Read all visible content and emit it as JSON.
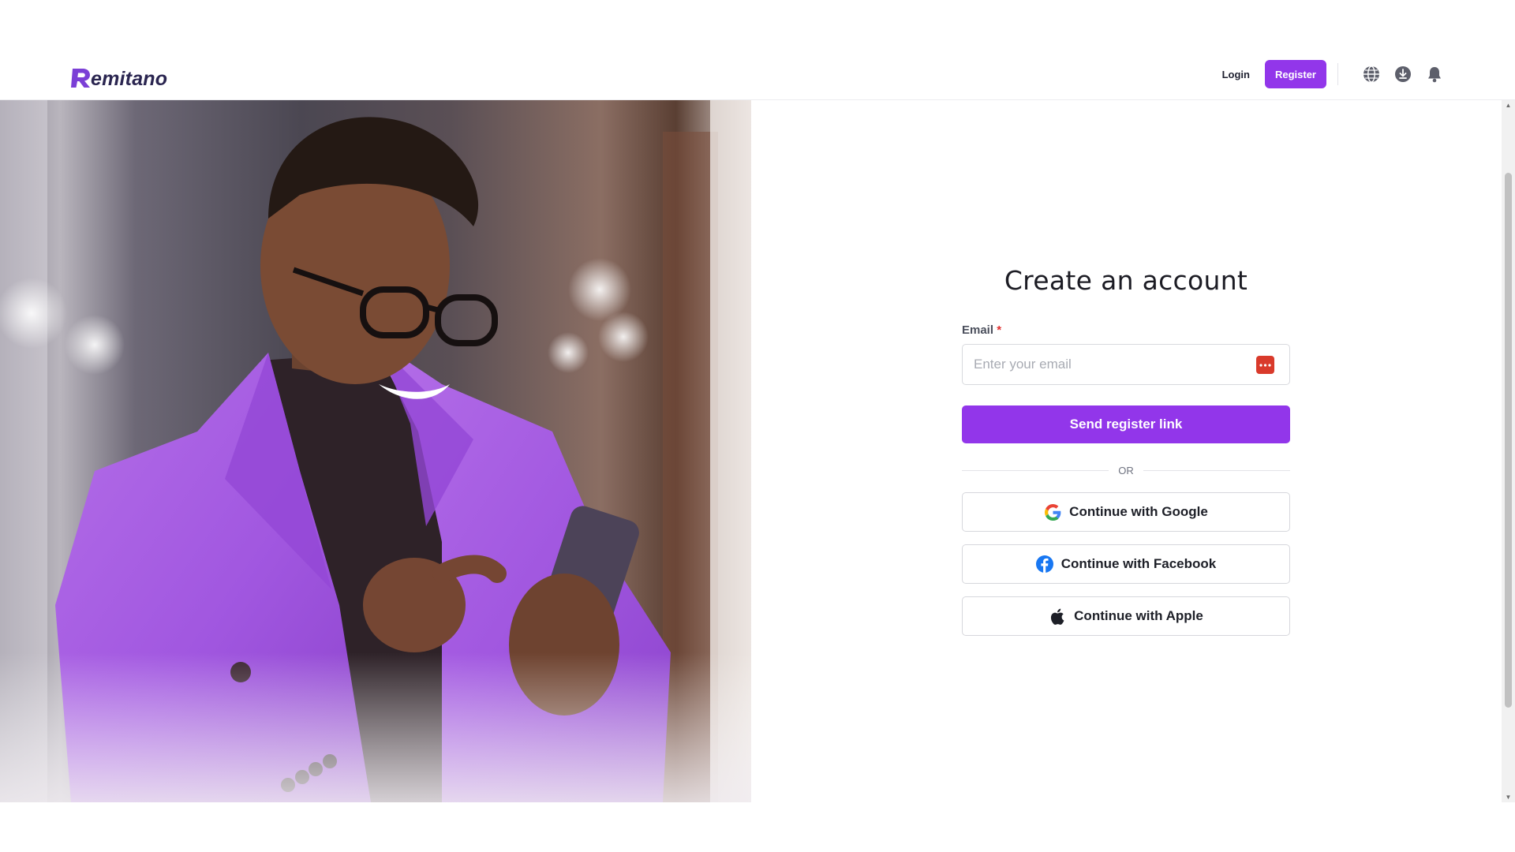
{
  "brand": {
    "name": "Remitano",
    "logo_text": "emitano",
    "accent": "#9236ea"
  },
  "header": {
    "login_label": "Login",
    "register_label": "Register",
    "icons": [
      "globe-icon",
      "download-icon",
      "bell-icon"
    ]
  },
  "auth": {
    "title": "Create an account",
    "email_label": "Email",
    "required_mark": "*",
    "email_placeholder": "Enter your email",
    "email_value": "",
    "send_button": "Send register link",
    "or_text": "OR",
    "google_button": "Continue with Google",
    "facebook_button": "Continue with Facebook",
    "apple_button": "Continue with Apple"
  }
}
